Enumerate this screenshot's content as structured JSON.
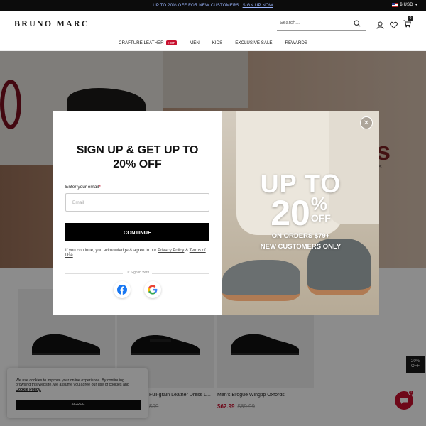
{
  "topbar": {
    "promo_text": "UP TO 20% OFF FOR NEW CUSTOMERS.",
    "promo_link": "SIGN UP NOW",
    "currency": "$ USD"
  },
  "header": {
    "logo": "BRUNO MARC",
    "search_placeholder": "Search...",
    "cart_count": "0"
  },
  "nav": {
    "items": [
      {
        "label": "CRAFTURE LEATHER",
        "badge": "HOT"
      },
      {
        "label": "MEN"
      },
      {
        "label": "KIDS"
      },
      {
        "label": "EXCLUSIVE SALE"
      },
      {
        "label": "REWARDS"
      }
    ]
  },
  "hero": {
    "partial_title": "s",
    "partial_text": "s."
  },
  "products": [
    {
      "name": "",
      "price": "",
      "original_price": ""
    },
    {
      "name": "Full-grain Leather Dress L...",
      "price": "",
      "original_price": "$99"
    },
    {
      "name": "Men's Brogue Wingtip Oxfords",
      "price": "$62.99",
      "original_price": "$69.99"
    }
  ],
  "cookie": {
    "text": "We use cookies to improve your online experience. By continuing browsing this website, we assume you agree our use of cookies and ",
    "policy_link": "Cookie Policy.",
    "agree_label": "AGREE"
  },
  "badge": {
    "line1": "20%",
    "line2": "OFF"
  },
  "chat": {
    "count": "1"
  },
  "modal": {
    "title_line1": "SIGN UP & GET UP TO",
    "title_line2": "20% OFF",
    "email_label": "Enter your email",
    "email_required": "*",
    "email_placeholder": "Email",
    "continue_label": "CONTINUE",
    "terms_prefix": "If you continue, you acknowledge & agree to our ",
    "privacy_link": "Privacy Policy",
    "terms_and": " & ",
    "terms_link": "Terms of Use",
    "or_sign_in": "Or Sign in With",
    "promo_upto": "UP TO",
    "promo_pct": "20",
    "promo_pct_sign": "%",
    "promo_off": "OFF",
    "promo_cond1": "ON ORDERS $79+",
    "promo_cond2": "NEW CUSTOMERS ONLY"
  },
  "colors": {
    "accent_red": "#c8102e",
    "black": "#000000",
    "link_blue": "#9bb6ff"
  }
}
